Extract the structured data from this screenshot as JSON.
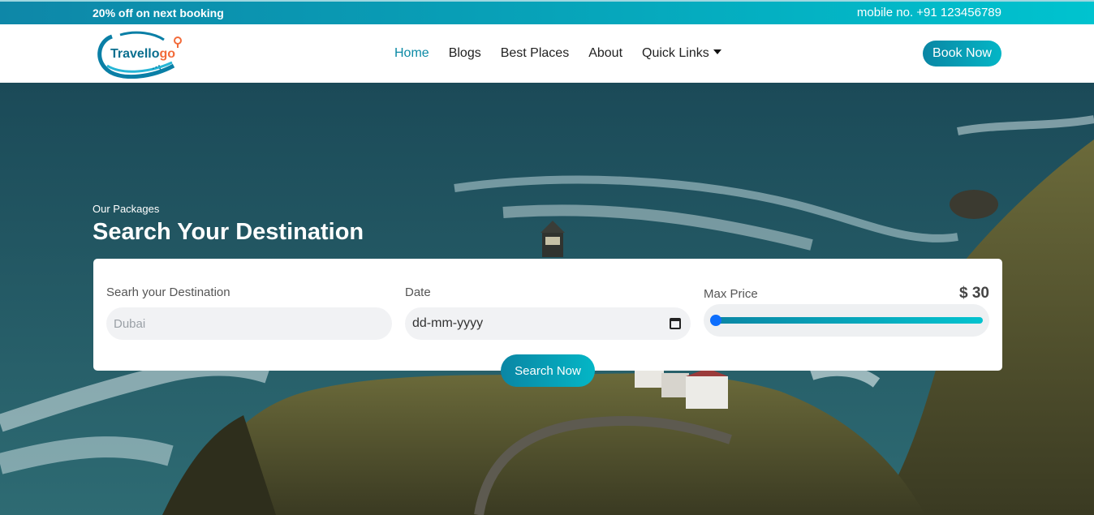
{
  "topbar": {
    "promo": "20% off on next booking",
    "phone": "mobile no. +91 123456789"
  },
  "navbar": {
    "logo_text": "Travello",
    "logo_text_accent": "go",
    "items": [
      {
        "label": "Home",
        "active": true
      },
      {
        "label": "Blogs"
      },
      {
        "label": "Best Places"
      },
      {
        "label": "About"
      },
      {
        "label": "Quick Links",
        "dropdown": true
      }
    ],
    "book_label": "Book Now"
  },
  "hero": {
    "subtitle": "Our Packages",
    "title": "Search Your Destination"
  },
  "search": {
    "destination_label": "Searh your Destination",
    "destination_placeholder": "Dubai",
    "date_label": "Date",
    "date_value": "dd-mm-yyyy",
    "price_label": "Max Price",
    "price_value": "$ 30",
    "price_slider_fraction": 0.0,
    "button_label": "Search Now"
  },
  "colors": {
    "accent": "#0a86a4",
    "accent_light": "#04c3cf",
    "slider_thumb": "#0d6efd"
  }
}
